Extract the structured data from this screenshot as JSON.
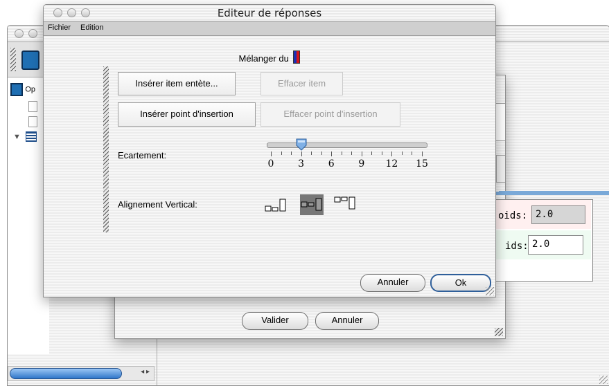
{
  "main_window": {
    "tree_label": "Op",
    "scroll_arrows": "◂ ▸"
  },
  "middle_dialog": {
    "poids_label_1": "oids:",
    "poids_value_1": "2.0",
    "poids_label_2": "ids:",
    "poids_value_2": "2.0",
    "valider_label": "Valider",
    "annuler_label": "Annuler"
  },
  "editor": {
    "title": "Editeur de réponses",
    "menu": [
      "Fichier",
      "Edition"
    ],
    "header_text": "Mélanger du",
    "flag_colors": [
      "#1b2fb5",
      "#d4141b"
    ],
    "insert_header_button": "Insérer item entète...",
    "delete_item_button": "Effacer item",
    "insert_point_button": "Insérer point d'insertion",
    "delete_point_button": "Effacer point d'insertion",
    "spacing_label": "Ecartement:",
    "slider": {
      "min": 0,
      "max": 15,
      "value": 3,
      "tick_labels": [
        "0",
        "3",
        "6",
        "9",
        "12",
        "15"
      ]
    },
    "vertical_alignment_label": "Alignement Vertical:",
    "alignment_options": [
      "align-bottom",
      "align-center",
      "align-top"
    ],
    "selected_alignment": "align-center",
    "cancel_button": "Annuler",
    "ok_button": "Ok"
  }
}
